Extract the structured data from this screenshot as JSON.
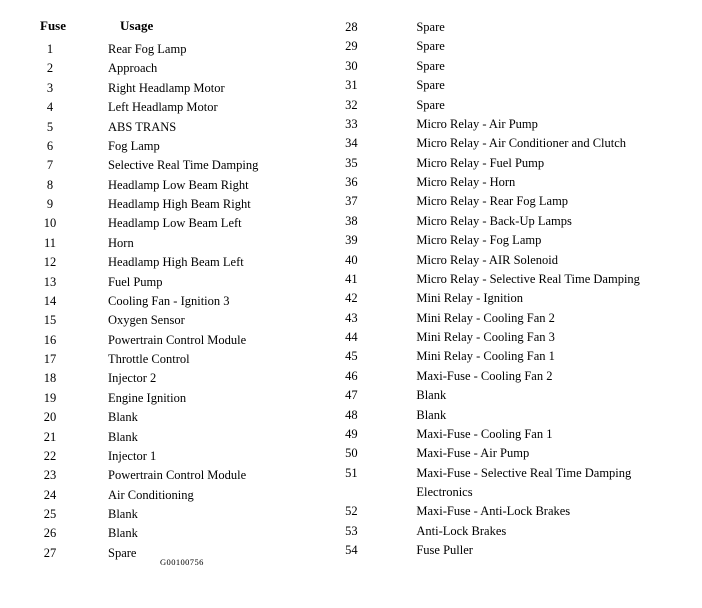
{
  "header": {
    "fuse": "Fuse",
    "usage": "Usage"
  },
  "left_column": [
    {
      "num": "1",
      "usage": "Rear Fog Lamp"
    },
    {
      "num": "2",
      "usage": "Approach"
    },
    {
      "num": "3",
      "usage": "Right Headlamp Motor"
    },
    {
      "num": "4",
      "usage": "Left Headlamp Motor"
    },
    {
      "num": "5",
      "usage": "ABS TRANS"
    },
    {
      "num": "6",
      "usage": "Fog Lamp"
    },
    {
      "num": "7",
      "usage": "Selective Real Time Damping"
    },
    {
      "num": "8",
      "usage": "Headlamp Low Beam Right"
    },
    {
      "num": "9",
      "usage": "Headlamp High Beam Right"
    },
    {
      "num": "10",
      "usage": "Headlamp Low Beam Left"
    },
    {
      "num": "11",
      "usage": "Horn"
    },
    {
      "num": "12",
      "usage": "Headlamp High Beam Left"
    },
    {
      "num": "13",
      "usage": "Fuel Pump"
    },
    {
      "num": "14",
      "usage": "Cooling Fan - Ignition 3"
    },
    {
      "num": "15",
      "usage": "Oxygen Sensor"
    },
    {
      "num": "16",
      "usage": "Powertrain Control Module"
    },
    {
      "num": "17",
      "usage": "Throttle Control"
    },
    {
      "num": "18",
      "usage": "Injector 2"
    },
    {
      "num": "19",
      "usage": "Engine Ignition"
    },
    {
      "num": "20",
      "usage": "Blank"
    },
    {
      "num": "21",
      "usage": "Blank"
    },
    {
      "num": "22",
      "usage": "Injector 1"
    },
    {
      "num": "23",
      "usage": "Powertrain Control Module"
    },
    {
      "num": "24",
      "usage": "Air Conditioning"
    },
    {
      "num": "25",
      "usage": "Blank"
    },
    {
      "num": "26",
      "usage": "Blank"
    },
    {
      "num": "27",
      "usage": "Spare"
    }
  ],
  "right_column": [
    {
      "num": "28",
      "usage": "Spare"
    },
    {
      "num": "29",
      "usage": "Spare"
    },
    {
      "num": "30",
      "usage": "Spare"
    },
    {
      "num": "31",
      "usage": "Spare"
    },
    {
      "num": "32",
      "usage": "Spare"
    },
    {
      "num": "33",
      "usage": "Micro Relay - Air Pump"
    },
    {
      "num": "34",
      "usage": "Micro Relay - Air Conditioner and Clutch"
    },
    {
      "num": "35",
      "usage": "Micro Relay - Fuel Pump"
    },
    {
      "num": "36",
      "usage": "Micro Relay - Horn"
    },
    {
      "num": "37",
      "usage": "Micro Relay - Rear Fog Lamp"
    },
    {
      "num": "38",
      "usage": "Micro Relay - Back-Up Lamps"
    },
    {
      "num": "39",
      "usage": "Micro Relay - Fog Lamp"
    },
    {
      "num": "40",
      "usage": "Micro Relay - AIR Solenoid"
    },
    {
      "num": "41",
      "usage": "Micro Relay - Selective Real Time Damping"
    },
    {
      "num": "42",
      "usage": "Mini Relay - Ignition"
    },
    {
      "num": "43",
      "usage": "Mini Relay - Cooling Fan 2"
    },
    {
      "num": "44",
      "usage": "Mini Relay - Cooling Fan 3"
    },
    {
      "num": "45",
      "usage": "Mini Relay - Cooling Fan 1"
    },
    {
      "num": "46",
      "usage": "Maxi-Fuse - Cooling Fan 2"
    },
    {
      "num": "47",
      "usage": "Blank"
    },
    {
      "num": "48",
      "usage": "Blank"
    },
    {
      "num": "49",
      "usage": "Maxi-Fuse - Cooling Fan 1"
    },
    {
      "num": "50",
      "usage": "Maxi-Fuse - Air Pump"
    },
    {
      "num": "51",
      "usage": "Maxi-Fuse - Selective Real Time Damping Electronics"
    },
    {
      "num": "52",
      "usage": "Maxi-Fuse - Anti-Lock Brakes"
    },
    {
      "num": "53",
      "usage": "Anti-Lock Brakes"
    },
    {
      "num": "54",
      "usage": "Fuse Puller"
    }
  ],
  "footnote": "G00100756"
}
